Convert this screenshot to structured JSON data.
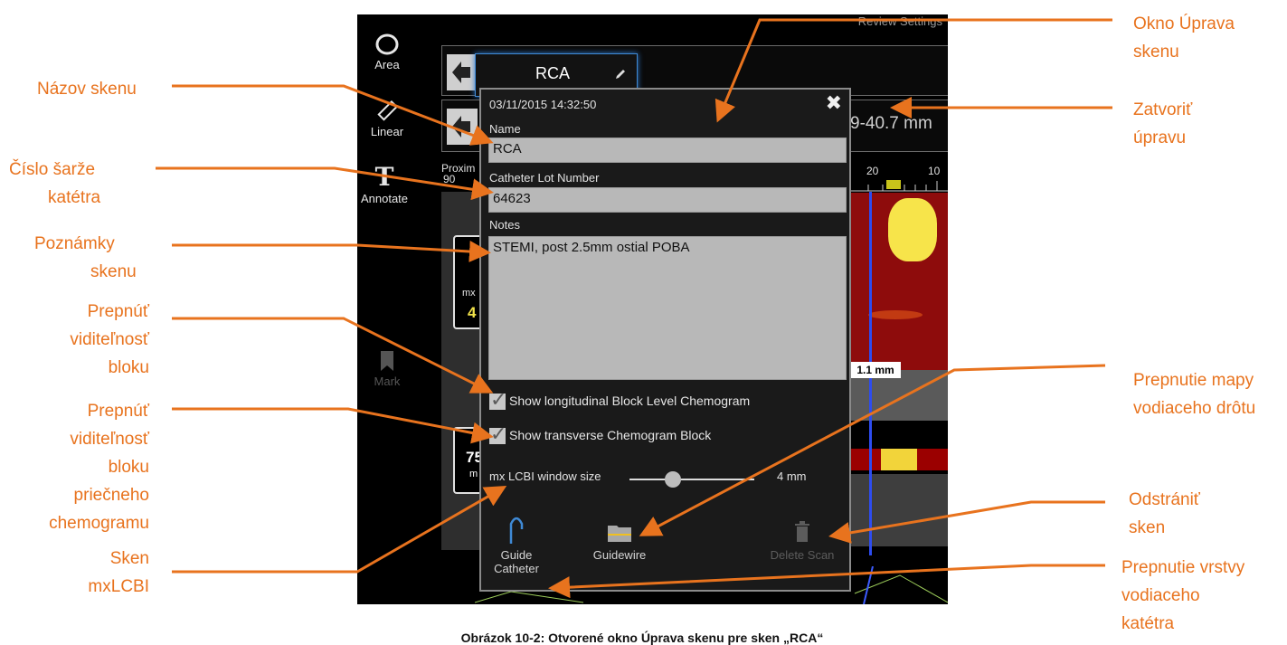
{
  "callouts": {
    "scan_name": "Názov skenu",
    "catheter_lot_1": "Číslo šarže",
    "catheter_lot_2": "katétra",
    "notes_1": "Poznámky",
    "notes_2": "skenu",
    "toggle_block_1": "Prepnúť",
    "toggle_block_2": "viditeľnosť",
    "toggle_block_3": "bloku",
    "toggle_trans_1": "Prepnúť",
    "toggle_trans_2": "viditeľnosť",
    "toggle_trans_3": "bloku",
    "toggle_trans_4": "priečneho",
    "toggle_trans_5": "chemogramu",
    "mxlcbi_1": "Sken",
    "mxlcbi_2": "mxLCBI",
    "edit_window_1": "Okno Úprava",
    "edit_window_2": "skenu",
    "close_edit_1": "Zatvoriť",
    "close_edit_2": "úpravu",
    "guidewire_map_1": "Prepnutie mapy",
    "guidewire_map_2": "vodiaceho drôtu",
    "delete_scan_1": "Odstrániť",
    "delete_scan_2": "sken",
    "guide_layer_1": "Prepnutie vrstvy",
    "guide_layer_2": "vodiaceho",
    "guide_layer_3": "katétra"
  },
  "app": {
    "nav": "Review   Settings",
    "tools": {
      "area": "Area",
      "linear": "Linear",
      "annotate": "Annotate",
      "mark": "Mark"
    },
    "scan_tab": "RCA",
    "measurement": "9-40.7 mm",
    "proximal": "Proxim",
    "tick_90": "90",
    "tick_20": "20",
    "tick_10": "10",
    "distance_label": "1.1 mm",
    "mx_small": "mx",
    "val_4": "4",
    "val_75": "75",
    "m_small": "m"
  },
  "dialog": {
    "timestamp": "03/11/2015 14:32:50",
    "name_label": "Name",
    "name_value": "RCA",
    "lot_label": "Catheter Lot Number",
    "lot_value": "64623",
    "notes_label": "Notes",
    "notes_value": "STEMI, post 2.5mm ostial POBA",
    "chk_longitudinal": "Show longitudinal Block Level Chemogram",
    "chk_transverse": "Show transverse Chemogram Block",
    "window_label": "mx LCBI window size",
    "window_value": "4 mm",
    "slider_fraction": 0.35,
    "guide_catheter_1": "Guide",
    "guide_catheter_2": "Catheter",
    "guidewire": "Guidewire",
    "delete_scan": "Delete Scan"
  },
  "caption": "Obrázok 10-2: Otvorené okno Úprava skenu pre sken „RCA“",
  "colors": {
    "accent": "#e8731e",
    "highlight": "#3f8ad6"
  }
}
